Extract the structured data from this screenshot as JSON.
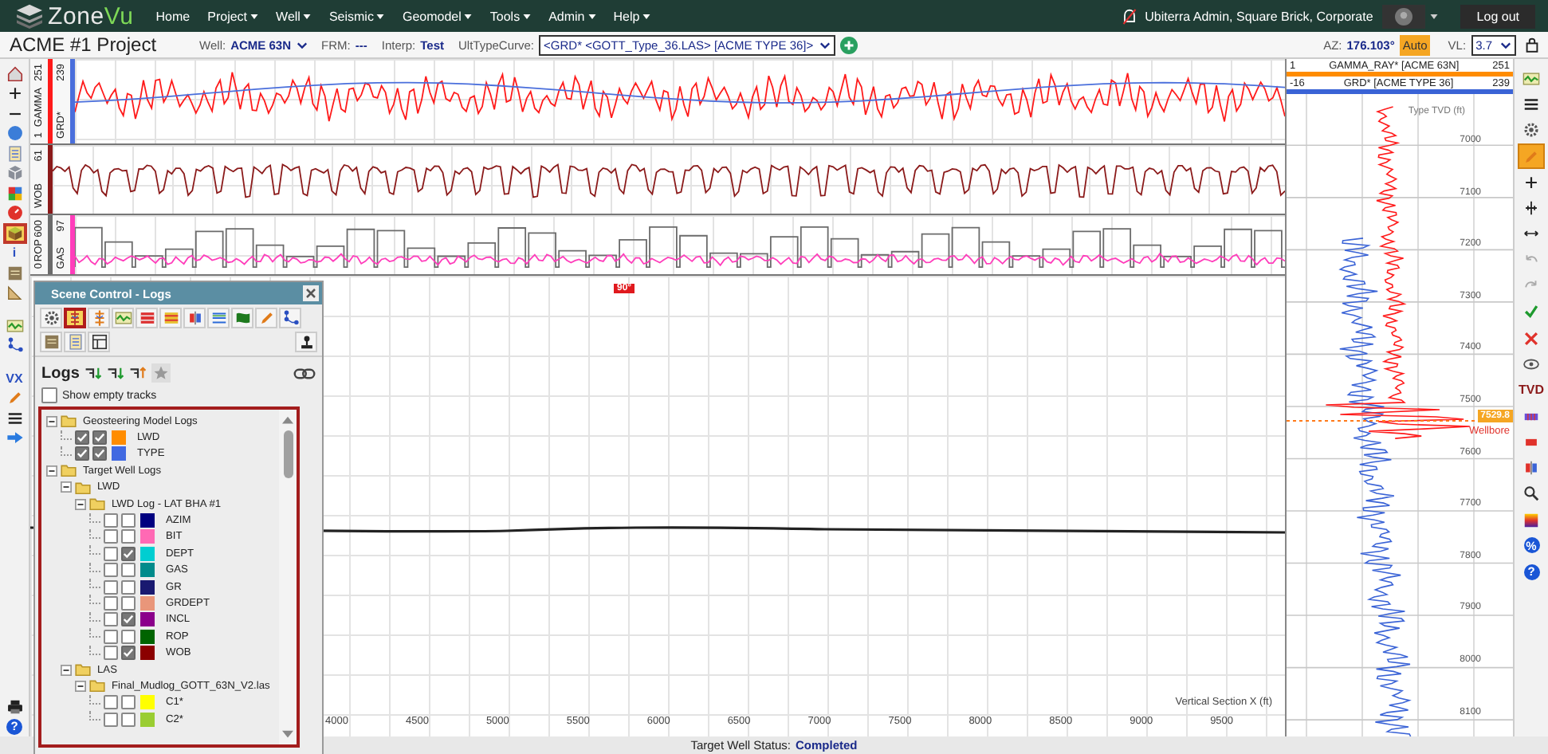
{
  "header": {
    "logo": {
      "text": "Zone",
      "accent": "Vu"
    },
    "nav": [
      {
        "label": "Home",
        "menu": false
      },
      {
        "label": "Project",
        "menu": true
      },
      {
        "label": "Well",
        "menu": true
      },
      {
        "label": "Seismic",
        "menu": true
      },
      {
        "label": "Geomodel",
        "menu": true
      },
      {
        "label": "Tools",
        "menu": true
      },
      {
        "label": "Admin",
        "menu": true
      },
      {
        "label": "Help",
        "menu": true
      }
    ],
    "user": "Ubiterra Admin, Square Brick, Corporate",
    "logout": "Log out"
  },
  "toolbar": {
    "project": "ACME #1 Project",
    "fields": [
      {
        "label": "Well:",
        "value": "ACME 63N",
        "dropdown": true
      },
      {
        "label": "FRM:",
        "value": "---",
        "dropdown": false
      },
      {
        "label": "Interp:",
        "value": "Test",
        "dropdown": false
      }
    ],
    "type_curve": {
      "label": "UltTypeCurve:",
      "value": "<GRD* <GOTT_Type_36.LAS> [ACME TYPE 36]>"
    },
    "azimuth": {
      "label": "AZ:",
      "value": "176.103°",
      "mode": "Auto"
    },
    "vl": {
      "label": "VL:",
      "value": "3.7"
    }
  },
  "left_toolbar": [
    {
      "kind": "home",
      "selected": false
    },
    {
      "kind": "plus",
      "selected": false
    },
    {
      "kind": "minus",
      "selected": false
    },
    {
      "kind": "compass",
      "selected": false
    },
    {
      "kind": "panel",
      "selected": false
    },
    {
      "kind": "cube",
      "selected": false
    },
    {
      "kind": "map",
      "selected": false
    },
    {
      "kind": "gauge",
      "selected": false
    },
    {
      "kind": "block",
      "selected": true
    },
    {
      "kind": "text",
      "label": "i",
      "selected": false
    },
    {
      "kind": "layers",
      "selected": false
    },
    {
      "kind": "ruler",
      "selected": false
    },
    {
      "kind": "gap"
    },
    {
      "kind": "chart",
      "selected": false
    },
    {
      "kind": "nodes",
      "selected": false
    },
    {
      "kind": "gap"
    },
    {
      "kind": "text",
      "label": "VX",
      "selected": false
    },
    {
      "kind": "pencil",
      "selected": false
    },
    {
      "kind": "list",
      "selected": false
    },
    {
      "kind": "arrow",
      "selected": false
    },
    {
      "kind": "spacer"
    },
    {
      "kind": "printer",
      "selected": false
    },
    {
      "kind": "circle",
      "label": "?",
      "selected": false
    }
  ],
  "tracks": [
    {
      "curves": [
        {
          "min": "1",
          "name": "GAMMA",
          "max": "251",
          "color": "#ff1a1a"
        },
        {
          "name": "GRD*",
          "max": "239",
          "color": "#4a6fdc"
        }
      ]
    },
    {
      "curves": [
        {
          "name": "WOB",
          "max": "61",
          "color": "#8b1a1a"
        }
      ]
    },
    {
      "curves": [
        {
          "min": "0",
          "name": "ROP",
          "max": "600",
          "color": "#6b6b6b"
        },
        {
          "name": "GAS",
          "max": "97",
          "color": "#ff3dbb"
        }
      ]
    }
  ],
  "section": {
    "marker": "90°",
    "x_label": "Vertical Section X (ft)",
    "x_ticks": [
      "4000",
      "4500",
      "5000",
      "5500",
      "6000",
      "6500",
      "7000",
      "7500",
      "8000",
      "8500",
      "9000",
      "9500"
    ]
  },
  "scene_control": {
    "title": "Scene Control - Logs",
    "tools": [
      {
        "kind": "gear",
        "selected": false
      },
      {
        "kind": "ladder",
        "selected": true
      },
      {
        "kind": "ladder2",
        "selected": false
      },
      {
        "kind": "chart",
        "selected": false
      },
      {
        "kind": "redbars",
        "selected": false
      },
      {
        "kind": "yellowbars",
        "selected": false
      },
      {
        "kind": "split",
        "selected": false
      },
      {
        "kind": "bluelines",
        "selected": false
      },
      {
        "kind": "flag",
        "selected": false
      },
      {
        "kind": "pencil",
        "selected": false
      },
      {
        "kind": "nodes",
        "selected": false
      },
      {
        "kind": "break"
      },
      {
        "kind": "layers",
        "selected": false
      },
      {
        "kind": "panel",
        "selected": false
      },
      {
        "kind": "layout",
        "selected": false
      },
      {
        "kind": "joystick",
        "selected": false
      }
    ],
    "logs_label": "Logs",
    "show_empty_tracks": {
      "label": "Show empty tracks",
      "checked": false
    },
    "tree": [
      {
        "kind": "folder",
        "label": "Geosteering Model Logs",
        "expanded": true,
        "children": [
          {
            "kind": "log",
            "label": "LWD",
            "checks": [
              true,
              true
            ],
            "color": "#ff8c00"
          },
          {
            "kind": "log",
            "label": "TYPE",
            "checks": [
              true,
              true
            ],
            "color": "#4169e1"
          }
        ]
      },
      {
        "kind": "folder",
        "label": "Target Well Logs",
        "expanded": true,
        "children": [
          {
            "kind": "folder",
            "label": "LWD",
            "expanded": true,
            "children": [
              {
                "kind": "folder",
                "label": "LWD Log - LAT BHA #1",
                "expanded": true,
                "children": [
                  {
                    "kind": "log",
                    "label": "AZIM",
                    "checks": [
                      false,
                      false
                    ],
                    "color": "#000080"
                  },
                  {
                    "kind": "log",
                    "label": "BIT",
                    "checks": [
                      false,
                      false
                    ],
                    "color": "#ff69b4"
                  },
                  {
                    "kind": "log",
                    "label": "DEPT",
                    "checks": [
                      false,
                      true
                    ],
                    "color": "#00ced1"
                  },
                  {
                    "kind": "log",
                    "label": "GAS",
                    "checks": [
                      false,
                      false
                    ],
                    "color": "#008b8b"
                  },
                  {
                    "kind": "log",
                    "label": "GR",
                    "checks": [
                      false,
                      false
                    ],
                    "color": "#191970"
                  },
                  {
                    "kind": "log",
                    "label": "GRDEPT",
                    "checks": [
                      false,
                      false
                    ],
                    "color": "#e9967a"
                  },
                  {
                    "kind": "log",
                    "label": "INCL",
                    "checks": [
                      false,
                      true
                    ],
                    "color": "#8b008b"
                  },
                  {
                    "kind": "log",
                    "label": "ROP",
                    "checks": [
                      false,
                      false
                    ],
                    "color": "#006400"
                  },
                  {
                    "kind": "log",
                    "label": "WOB",
                    "checks": [
                      false,
                      true
                    ],
                    "color": "#8b0000"
                  }
                ]
              }
            ]
          },
          {
            "kind": "folder",
            "label": "LAS",
            "expanded": true,
            "children": [
              {
                "kind": "folder",
                "label": "Final_Mudlog_GOTT_63N_V2.las",
                "expanded": true,
                "children": [
                  {
                    "kind": "log",
                    "label": "C1*",
                    "checks": [
                      false,
                      false
                    ],
                    "color": "#ffff00"
                  },
                  {
                    "kind": "log",
                    "label": "C2*",
                    "checks": [
                      false,
                      false
                    ],
                    "color": "#9acd32"
                  }
                ]
              }
            ]
          }
        ]
      }
    ]
  },
  "type_log": {
    "curves": [
      {
        "min": "1",
        "name": "GAMMA_RAY* [ACME 63N]",
        "max": "251",
        "color": "#ff8c00"
      },
      {
        "min": "-16",
        "name": "GRD* [ACME TYPE 36]",
        "max": "239",
        "color": "#3a63d6"
      }
    ],
    "axis_title": "Type TVD (ft)",
    "depth_ticks": [
      "7000",
      "7100",
      "7200",
      "7300",
      "7400",
      "7500",
      "7600",
      "7700",
      "7800",
      "7900",
      "8000",
      "8100"
    ],
    "current_depth": "7529.8",
    "wellbore_label": "Wellbore"
  },
  "right_toolbar": [
    {
      "kind": "chart",
      "selected": false
    },
    {
      "kind": "list",
      "selected": false
    },
    {
      "kind": "gear",
      "selected": false
    },
    {
      "kind": "pencil",
      "selected": true
    },
    {
      "kind": "plus",
      "selected": false
    },
    {
      "kind": "crosshair",
      "selected": false
    },
    {
      "kind": "arrows",
      "selected": false
    },
    {
      "kind": "undo",
      "selected": false
    },
    {
      "kind": "redo",
      "selected": false
    },
    {
      "kind": "check",
      "selected": false
    },
    {
      "kind": "close",
      "selected": false
    },
    {
      "kind": "eye",
      "selected": false
    },
    {
      "kind": "text",
      "label": "TVD",
      "selected": false
    },
    {
      "kind": "bars",
      "selected": false
    },
    {
      "kind": "stop",
      "selected": false
    },
    {
      "kind": "split",
      "selected": false
    },
    {
      "kind": "search",
      "selected": false
    },
    {
      "kind": "gradient",
      "selected": false
    },
    {
      "kind": "circle",
      "label": "%",
      "selected": false
    },
    {
      "kind": "circle",
      "label": "?",
      "selected": false
    }
  ],
  "status_bar": {
    "label": "Target Well Status:",
    "value": "Completed"
  }
}
